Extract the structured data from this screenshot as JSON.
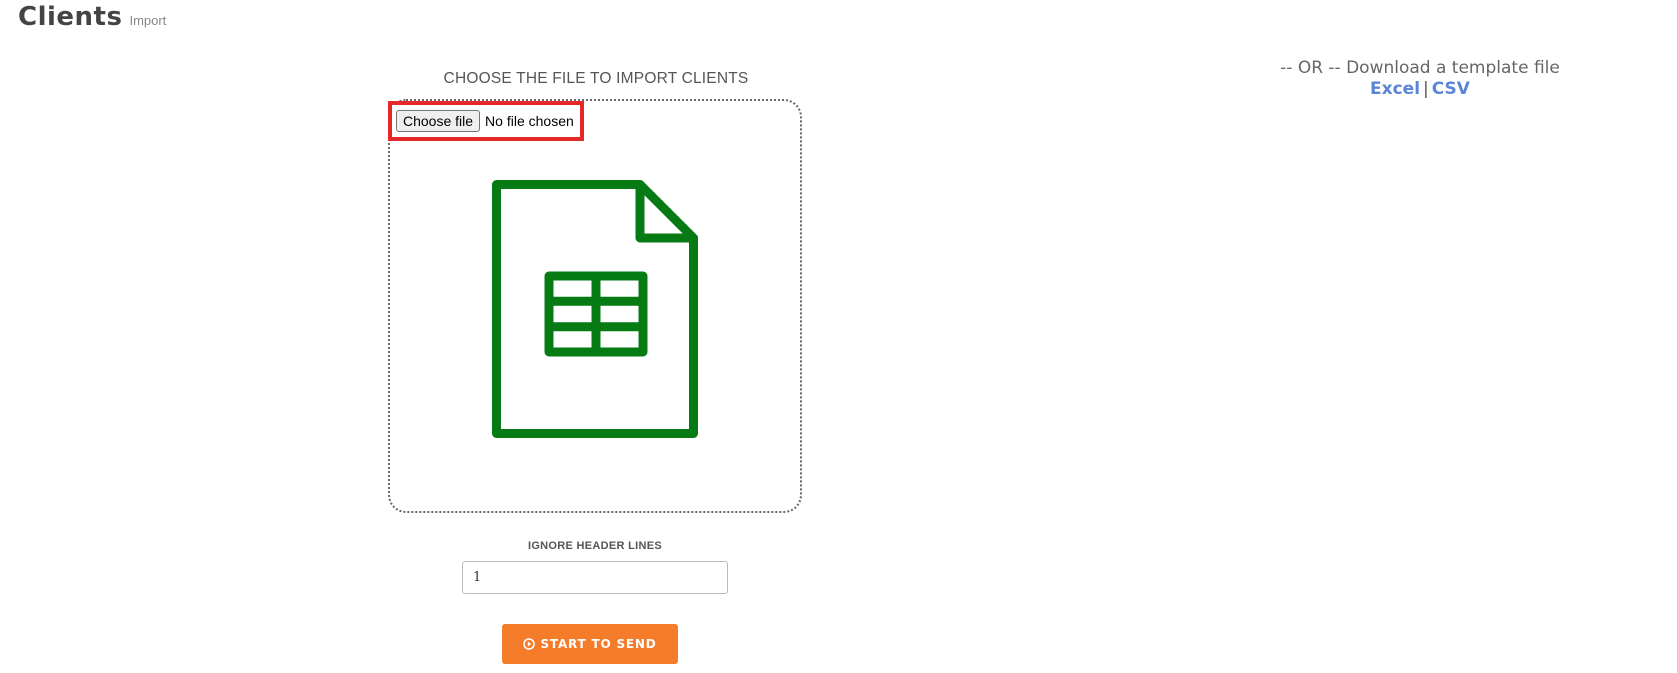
{
  "header": {
    "title": "Clients",
    "subtitle": "Import"
  },
  "upload": {
    "heading": "CHOOSE THE FILE TO IMPORT CLIENTS",
    "file_button_label": "Choose file",
    "file_status": "No file chosen",
    "icon": "spreadsheet-file-icon",
    "icon_color": "#067b14"
  },
  "template": {
    "text": "-- OR -- Download a template file",
    "excel_label": "Excel",
    "separator": "|",
    "csv_label": "CSV",
    "link_color": "#5b85d6"
  },
  "options": {
    "ignore_header_label": "IGNORE HEADER LINES",
    "ignore_header_value": "1"
  },
  "actions": {
    "start_label": "START TO SEND",
    "start_icon": "play-circle-icon",
    "start_color": "#f57c2b"
  },
  "highlight": {
    "color": "#e62828"
  }
}
